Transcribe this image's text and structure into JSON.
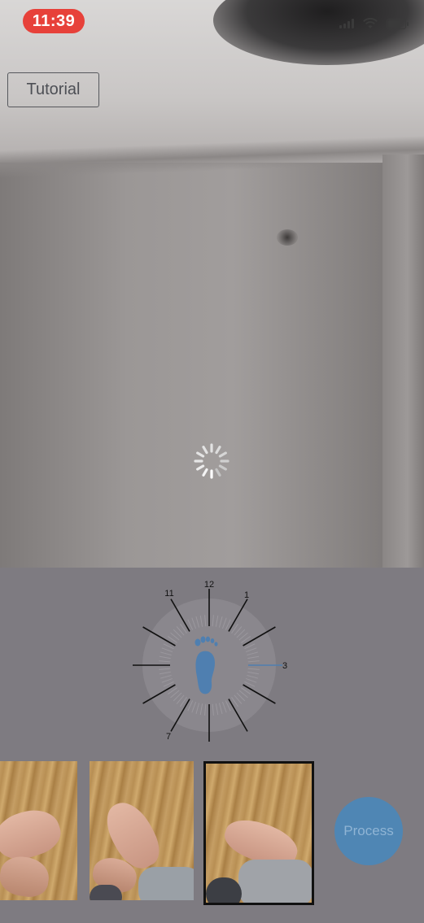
{
  "status": {
    "time": "11:39"
  },
  "toolbar": {
    "tutorial_label": "Tutorial"
  },
  "dial": {
    "labels": {
      "n12": "12",
      "n1": "1",
      "n3": "3",
      "n7": "7",
      "n11": "11"
    },
    "accent_color": "#4f7fb0"
  },
  "thumbnails": {
    "count": 3,
    "selected_index": 2
  },
  "actions": {
    "process_label": "Process"
  },
  "colors": {
    "recording_pill": "#e7413a",
    "process_button": "#4f86b4",
    "panel_background": "#7e7b81"
  }
}
